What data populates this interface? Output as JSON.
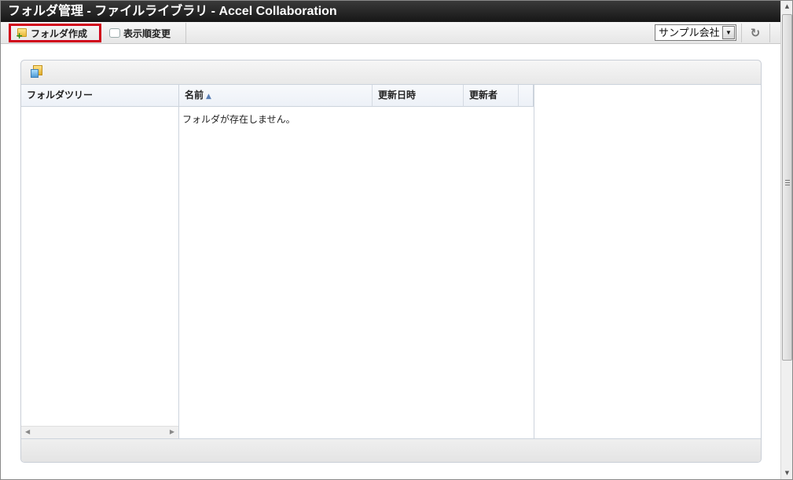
{
  "window": {
    "title": "フォルダ管理 - ファイルライブラリ - Accel Collaboration"
  },
  "toolbar": {
    "create_folder_label": "フォルダ作成",
    "change_order_label": "表示順変更",
    "company_select": {
      "selected": "サンプル会社"
    }
  },
  "tree": {
    "header": "フォルダツリー"
  },
  "list": {
    "columns": [
      "名前",
      "更新日時",
      "更新者"
    ],
    "sort_indicator": "▲",
    "empty_message": "フォルダが存在しません。"
  },
  "icons": [
    "folder-add-icon",
    "order-icon",
    "dropdown-arrow-icon",
    "refresh-icon",
    "file-library-icon"
  ],
  "colors": {
    "highlight_border": "#d0001a",
    "titlebar": "#1e1e1e"
  }
}
